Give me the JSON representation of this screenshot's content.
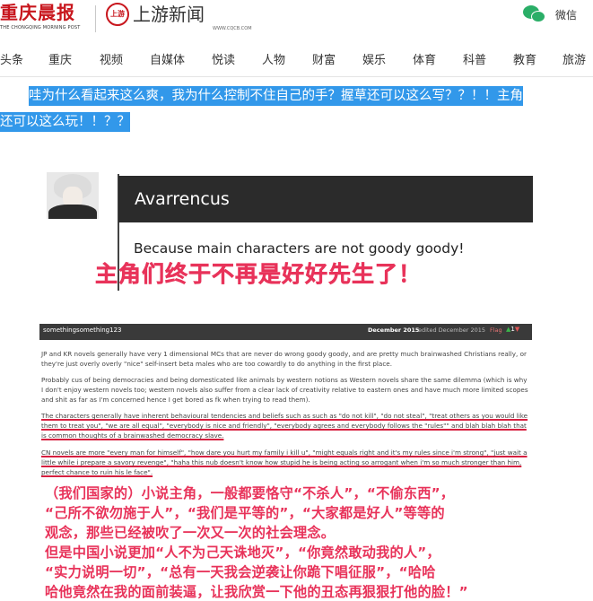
{
  "header": {
    "brand_name": "重庆晨报",
    "brand_sub": "THE CHONGQING MORNING POST",
    "partner_logo_text": "上游",
    "partner_name": "上游新闻",
    "partner_url": "WWW.CQCB.COM",
    "wechat_label": "微信"
  },
  "nav": {
    "items": [
      "头条",
      "重庆",
      "视频",
      "自媒体",
      "悦读",
      "人物",
      "财富",
      "娱乐",
      "体育",
      "科普",
      "教育",
      "旅游"
    ]
  },
  "article": {
    "headline_line1": "哇为什么看起来这么爽，我为什么控制不住自己的手？握草还可以这么写？？！！主角",
    "headline_line2": "还可以这么玩！！？？"
  },
  "card": {
    "username": "Avarrencus",
    "quote": "Because main characters are not goody goody!",
    "caption_cn": "主角们终于不再是好好先生了！"
  },
  "post": {
    "user": "somethingsomething123",
    "date": "December 2015",
    "edited": "edited December 2015",
    "flag": "Flag",
    "vote_up": "▲",
    "vote_count": "1",
    "vote_down": "▼",
    "p1": "JP and KR novels generally have very 1 dimensional MCs that are never do wrong goody goody, and are pretty much brainwashed Christians really, or they're just overly overly \"nice\" self-insert beta males who are too cowardly to do anything in the first place.",
    "p2": "Probably cus of being democracies and being domesticated like animals by western notions as Western novels share the same dilemma (which is why I don't enjoy western novels too; western novels also suffer from a clear lack of creativity relative to eastern ones and have much more limited scopes and shit as far as I'm concerned hence I get bored as fk when trying to read them).",
    "p3": "The characters generally have inherent behavioural tendencies and beliefs such as such as \"do not kill\", \"do not steal\", \"treat others as you would like them to treat you\", \"we are all equal\", \"everybody is nice and friendly\", \"everybody agrees and everybody follows the \"rules\"\" and blah blah blah that is common thoughts of a brainwashed democracy slave.",
    "p4": "CN novels are more \"every man for himself\", \"how dare you hurt my family i kill u\", \"might equals right and it's my rules since i'm strong\", \"just wait a little while i prepare a savory revenge\", \"haha this nub doesn't know how stupid he is being acting so arrogant when i'm so much stronger than him, perfect chance to ruin his le face\".",
    "cn_lines": [
      "（我们国家的）小说主角，一般都要恪守“不杀人”，“不偷东西”，",
      "“己所不欲勿施于人”，“我们是平等的”，“大家都是好人”等等的",
      "观念，那些已经被吹了一次又一次的社会理念。",
      "但是中国小说更加“人不为己天诛地灭”，“你竟然敢动我的人”，",
      "“实力说明一切”，“总有一天我会逆袭让你跪下唱征服”，“哈哈",
      "哈他竟然在我的面前装逼，让我欣赏一下他的丑态再狠狠打他的脸！”"
    ]
  },
  "colors": {
    "brand_red": "#c8161d",
    "wechat_green": "#2aae67",
    "headline_highlight": "#3298ea",
    "caption_pink": "#e8335a"
  }
}
